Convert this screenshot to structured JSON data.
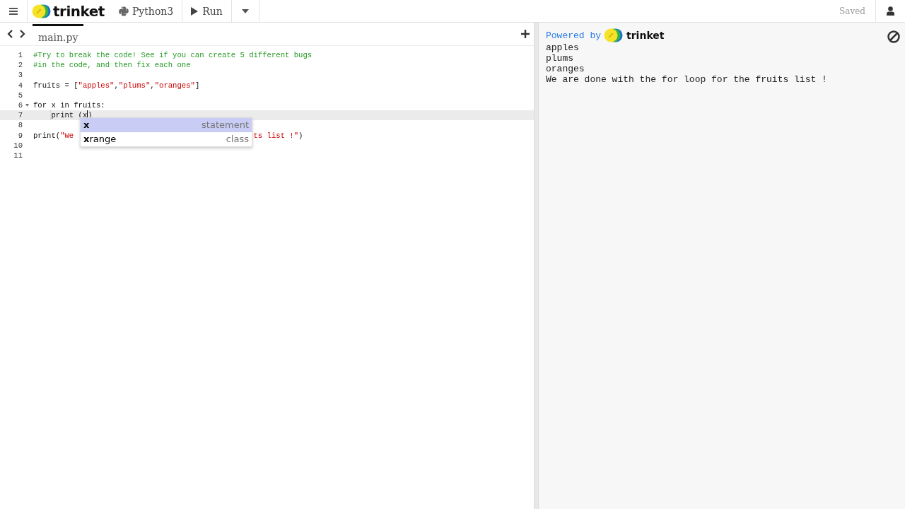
{
  "toolbar": {
    "brand": "trinket",
    "language": "Python3",
    "run_button": "Run",
    "status": "Saved"
  },
  "editor": {
    "tabs": [
      {
        "label": "main.py",
        "selected": true
      }
    ],
    "lines": [
      {
        "number": "1",
        "tokens": [
          {
            "kind": "comment",
            "text": "#Try to break the code! See if you can create 5 different bugs"
          }
        ]
      },
      {
        "number": "2",
        "tokens": [
          {
            "kind": "comment",
            "text": "#in the code, and then fix each one"
          }
        ]
      },
      {
        "number": "3"
      },
      {
        "number": "4",
        "tokens": [
          {
            "kind": "plain",
            "text": "fruits = ["
          },
          {
            "kind": "string",
            "text": "\"apples\""
          },
          {
            "kind": "plain",
            "text": ","
          },
          {
            "kind": "string",
            "text": "\"plums\""
          },
          {
            "kind": "plain",
            "text": ","
          },
          {
            "kind": "string",
            "text": "\"oranges\""
          },
          {
            "kind": "plain",
            "text": "]"
          }
        ]
      },
      {
        "number": "5"
      },
      {
        "number": "6",
        "foldable": true,
        "tokens": [
          {
            "kind": "plain",
            "text": "for x in fruits:"
          }
        ]
      },
      {
        "number": "7",
        "active": true,
        "tokens": [
          {
            "kind": "indent"
          },
          {
            "kind": "plain",
            "text": "print (x"
          },
          {
            "kind": "cursor"
          },
          {
            "kind": "plain",
            "text": ")"
          }
        ]
      },
      {
        "number": "8"
      },
      {
        "number": "9",
        "tokens": [
          {
            "kind": "plain",
            "text": "print("
          },
          {
            "kind": "string",
            "text": "\"We "
          },
          {
            "kind": "covered"
          },
          {
            "kind": "string",
            "text": "ts list !\""
          },
          {
            "kind": "plain",
            "text": ")"
          }
        ]
      },
      {
        "number": "10"
      },
      {
        "number": "11"
      }
    ],
    "autocomplete": [
      {
        "match": "x",
        "meta": "statement",
        "selected": true
      },
      {
        "match": "x",
        "rest": "range",
        "meta": "class",
        "selected": false
      }
    ]
  },
  "output": {
    "powered_by": "Powered by",
    "brand": "trinket",
    "lines": [
      "apples",
      "plums",
      "oranges",
      "We are done with the for loop for the fruits list !"
    ]
  }
}
